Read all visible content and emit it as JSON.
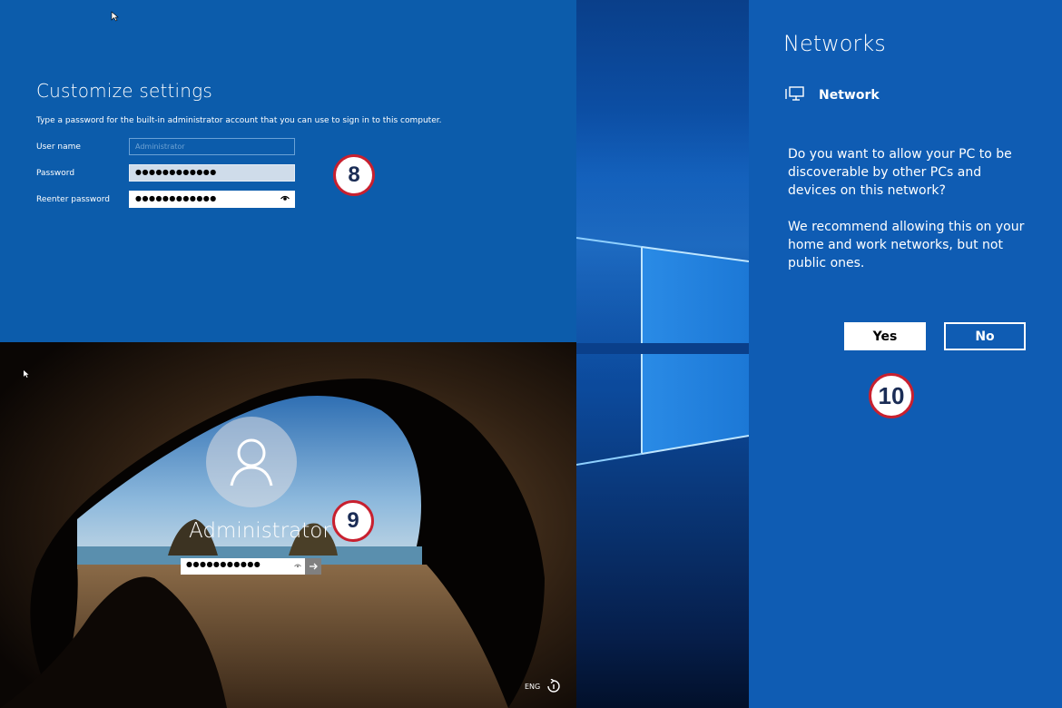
{
  "customize": {
    "title": "Customize settings",
    "description": "Type a password for the built-in administrator account that you can use to sign in to this computer.",
    "username_label": "User name",
    "username_placeholder": "Administrator",
    "password_label": "Password",
    "password_dots": "●●●●●●●●●●●●",
    "reenter_label": "Reenter password",
    "reenter_dots": "●●●●●●●●●●●●"
  },
  "lock_screen": {
    "username": "Administrator",
    "password_dots": "●●●●●●●●●●●",
    "language": "ENG"
  },
  "networks": {
    "title": "Networks",
    "network_name": "Network",
    "question": "Do you want to allow your PC to be discoverable by other PCs and devices on this network?",
    "recommendation": "We recommend allowing this on your home and work networks, but not public ones.",
    "yes_label": "Yes",
    "no_label": "No"
  },
  "steps": {
    "step_8": "8",
    "step_9": "9",
    "step_10": "10"
  },
  "colors": {
    "setup_blue": "#0c5cab",
    "network_blue": "#0f5cb3",
    "badge_ring": "#c8202f"
  },
  "icons": {
    "cursor": "mouse-pointer-icon",
    "eye": "eye-icon",
    "network": "network-pc-icon",
    "user": "user-avatar-icon",
    "arrow": "arrow-right-icon",
    "accessibility": "ease-of-access-icon"
  }
}
